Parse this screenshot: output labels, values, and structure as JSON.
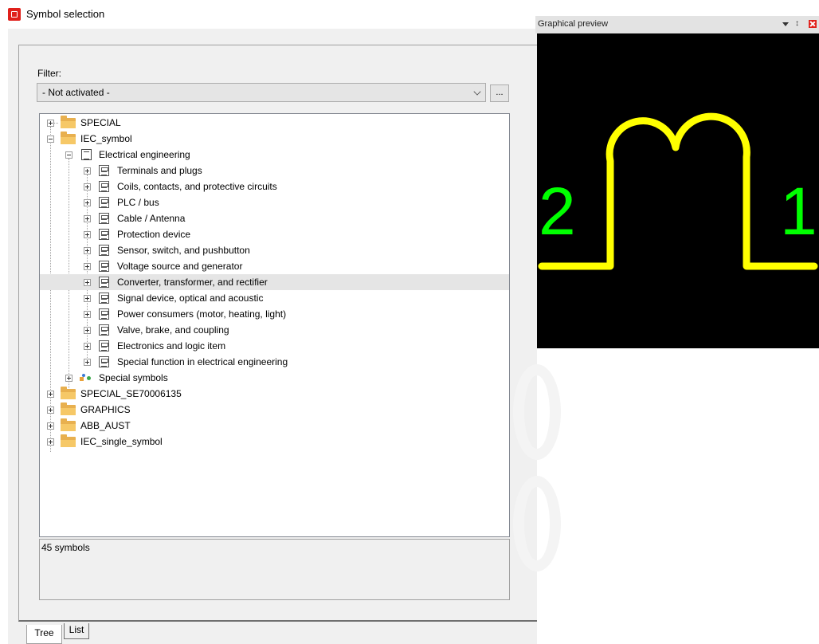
{
  "window": {
    "title": "Symbol selection"
  },
  "filter": {
    "label": "Filter:",
    "value": "- Not activated -",
    "more_button": "..."
  },
  "tree": {
    "nodes": [
      {
        "label": "SPECIAL"
      },
      {
        "label": "IEC_symbol"
      },
      {
        "label": "Electrical engineering"
      },
      {
        "label": "Terminals and plugs"
      },
      {
        "label": "Coils, contacts, and protective circuits"
      },
      {
        "label": "PLC / bus"
      },
      {
        "label": "Cable / Antenna"
      },
      {
        "label": "Protection device"
      },
      {
        "label": "Sensor, switch, and pushbutton"
      },
      {
        "label": "Voltage source and generator"
      },
      {
        "label": "Converter, transformer, and rectifier"
      },
      {
        "label": "Signal device, optical and acoustic"
      },
      {
        "label": "Power consumers (motor, heating, light)"
      },
      {
        "label": "Valve, brake, and coupling"
      },
      {
        "label": "Electronics and logic item"
      },
      {
        "label": "Special function in electrical engineering"
      },
      {
        "label": "Special symbols"
      },
      {
        "label": "SPECIAL_SE70006135"
      },
      {
        "label": "GRAPHICS"
      },
      {
        "label": "ABB_AUST"
      },
      {
        "label": "IEC_single_symbol"
      }
    ],
    "selected": "Converter, transformer, and rectifier"
  },
  "status": {
    "text": "45 symbols"
  },
  "tabs": {
    "tree": "Tree",
    "list": "List",
    "active": "Tree"
  },
  "preview": {
    "title": "Graphical preview",
    "pin_left": "2",
    "pin_right": "1",
    "symbol_color": "#ffff00",
    "pin_color": "#00ff00",
    "background": "#000000"
  },
  "colors": {
    "app_icon": "#e0201b",
    "selection": "#e5e5e5",
    "folder": "#e8b04f"
  }
}
